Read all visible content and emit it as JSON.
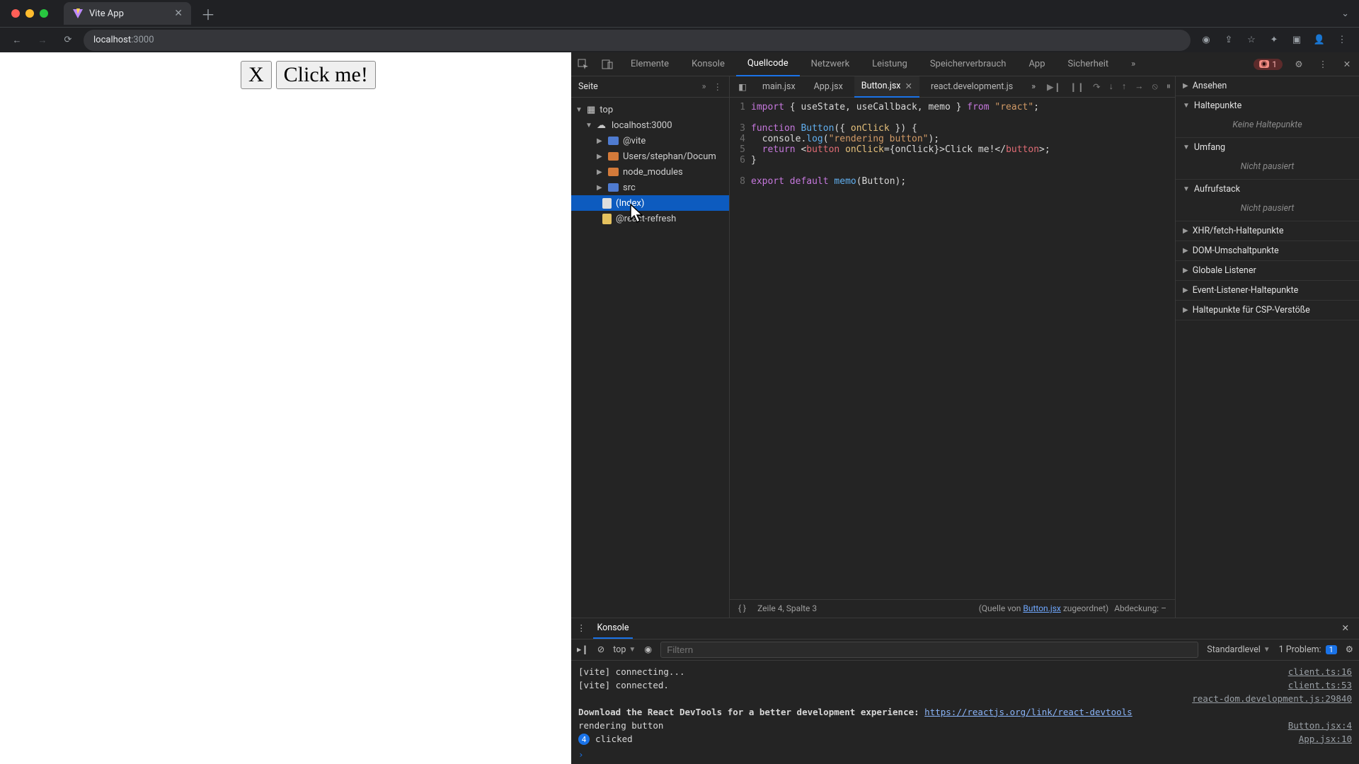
{
  "browser": {
    "tab_title": "Vite App",
    "url_host": "localhost",
    "url_port": ":3000"
  },
  "page": {
    "x_label": "X",
    "button_label": "Click me!"
  },
  "devtools": {
    "tabs": {
      "elements": "Elemente",
      "console": "Konsole",
      "sources": "Quellcode",
      "network": "Netzwerk",
      "performance": "Leistung",
      "memory": "Speicherverbrauch",
      "app": "App",
      "security": "Sicherheit"
    },
    "error_count": "1",
    "nav": {
      "site": "Seite",
      "top": "top",
      "origin": "localhost:3000",
      "items": [
        "@vite",
        "Users/stephan/Docum",
        "node_modules",
        "src",
        "(Index)",
        "@react-refresh"
      ]
    },
    "editor_tabs": [
      "main.jsx",
      "App.jsx",
      "Button.jsx",
      "react.development.js"
    ],
    "active_tab": "Button.jsx",
    "code_lines": {
      "n1": "1",
      "n3": "3",
      "n4": "4",
      "n5": "5",
      "n6": "6",
      "n8": "8"
    },
    "status_line": "Zeile 4, Spalte 3",
    "status_source_prefix": "(Quelle von ",
    "status_source_file": "Button.jsx",
    "status_source_suffix": " zugeordnet)",
    "status_coverage": "Abdeckung: –",
    "sidebar": {
      "watch": "Ansehen",
      "breakpoints": "Haltepunkte",
      "breakpoints_empty": "Keine Haltepunkte",
      "scope": "Umfang",
      "scope_empty": "Nicht pausiert",
      "callstack": "Aufrufstack",
      "callstack_empty": "Nicht pausiert",
      "xhr": "XHR/fetch-Haltepunkte",
      "dom": "DOM-Umschaltpunkte",
      "global": "Globale Listener",
      "event": "Event-Listener-Haltepunkte",
      "csp": "Haltepunkte für CSP-Verstöße"
    }
  },
  "console_drawer": {
    "title": "Konsole",
    "context": "top",
    "filter_placeholder": "Filtern",
    "level": "Standardlevel",
    "problems_label": "1 Problem:",
    "problems_count": "1",
    "logs": [
      {
        "msg": "[vite] connecting...",
        "src": "client.ts:16"
      },
      {
        "msg": "[vite] connected.",
        "src": "client.ts:53"
      },
      {
        "msg": "",
        "src": "react-dom.development.js:29840"
      },
      {
        "msg_prefix": "Download the React DevTools for a better development experience: ",
        "url": "https://reactjs.org/link/react-devtools",
        "src": ""
      },
      {
        "msg": "rendering button",
        "src": "Button.jsx:4"
      },
      {
        "count": "4",
        "msg": "clicked",
        "src": "App.jsx:10"
      }
    ]
  }
}
